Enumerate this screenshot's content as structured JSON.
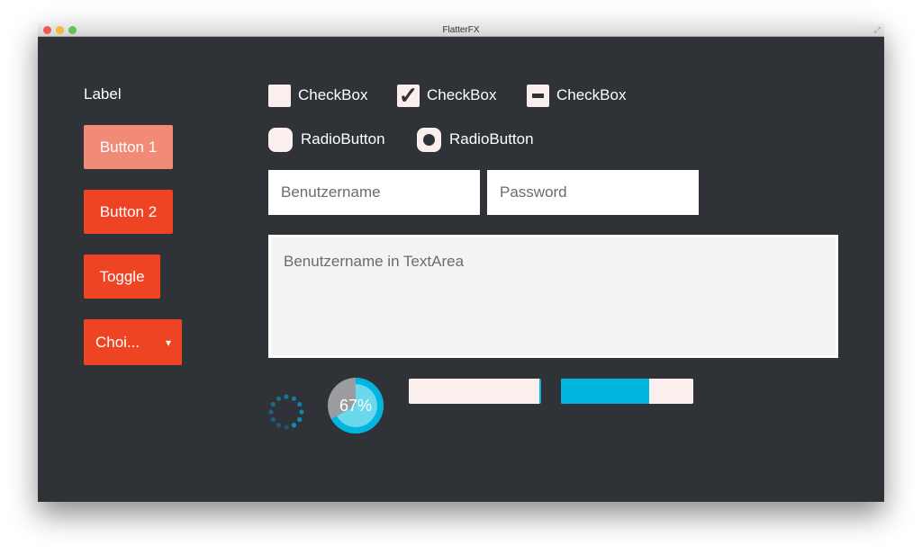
{
  "window": {
    "title": "FlatterFX"
  },
  "label": "Label",
  "buttons": {
    "button1": "Button 1",
    "button2": "Button 2",
    "toggle": "Toggle",
    "choice": "Choi...",
    "choice_arrow": "▾"
  },
  "checkboxes": [
    {
      "label": "CheckBox",
      "state": "unchecked"
    },
    {
      "label": "CheckBox",
      "state": "checked",
      "mark": "✓"
    },
    {
      "label": "CheckBox",
      "state": "indeterminate"
    }
  ],
  "radios": [
    {
      "label": "RadioButton",
      "selected": false
    },
    {
      "label": "RadioButton",
      "selected": true
    }
  ],
  "fields": {
    "username_placeholder": "Benutzername",
    "password_placeholder": "Password",
    "textarea_placeholder": "Benutzername in TextArea"
  },
  "progress_indicator": {
    "value_label": "67%",
    "value": 0.67
  },
  "progress_bars": [
    {
      "value": 0.0,
      "state": "indeterminate"
    },
    {
      "value": 0.67
    }
  ],
  "colors": {
    "accent": "#ef4423",
    "accent_light": "#f28a78",
    "blue": "#00b6de",
    "bg": "#2f3338"
  }
}
